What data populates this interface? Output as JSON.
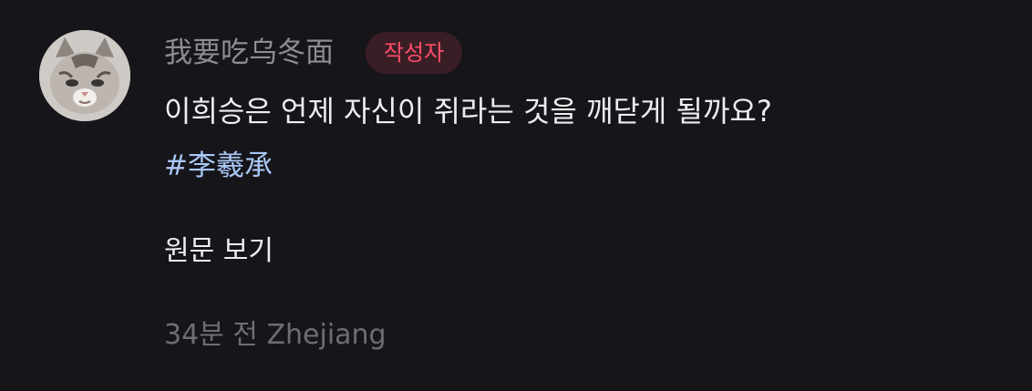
{
  "comment": {
    "avatar_icon": "cat-avatar-icon",
    "username": "我要吃乌冬面",
    "author_badge": "작성자",
    "text": "이희승은 언제 자신이 쥐라는 것을 깨닫게 될까요?",
    "hashtag": "#李羲承",
    "view_original_label": "원문 보기",
    "timestamp": "34분 전",
    "location": "Zhejiang"
  },
  "colors": {
    "background": "#16151a",
    "username": "#8e8c93",
    "badge_text": "#ff4d6a",
    "badge_bg": "#3a1e25",
    "body_text": "#ededf0",
    "hashtag": "#a9c7f5",
    "meta_text": "#6f6d74"
  }
}
